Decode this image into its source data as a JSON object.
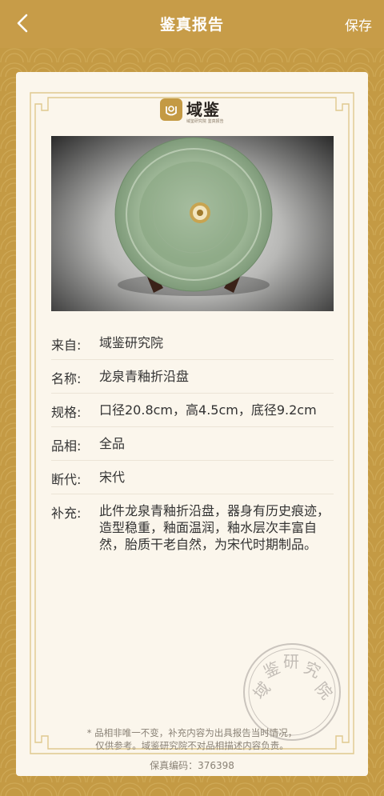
{
  "header": {
    "title": "鉴真报告",
    "save_label": "保存"
  },
  "brand": {
    "name": "域鉴",
    "tagline": "域鉴研究院 鉴真报告"
  },
  "rows": [
    {
      "key": "来自:",
      "value": "域鉴研究院"
    },
    {
      "key": "名称:",
      "value": "龙泉青釉折沿盘"
    },
    {
      "key": "规格:",
      "value": "口径20.8cm，高4.5cm，底径9.2cm"
    },
    {
      "key": "品相:",
      "value": "全品"
    },
    {
      "key": "断代:",
      "value": "宋代"
    },
    {
      "key": "补充:",
      "value": "此件龙泉青釉折沿盘，器身有历史痕迹，造型稳重，釉面温润，釉水层次丰富自然，胎质干老自然，为宋代时期制品。"
    }
  ],
  "footer": {
    "note_line1": "* 品相非唯一不变，补充内容为出具报告当时情况，",
    "note_line2": "仅供参考。域鉴研究院不对品相描述内容负责。",
    "code": "保真编码：376398"
  },
  "stamp": {
    "text": "域鉴研究院"
  },
  "colors": {
    "gold": "#c49a44",
    "card": "#fbf6ec",
    "stamp": "#9a9490"
  }
}
